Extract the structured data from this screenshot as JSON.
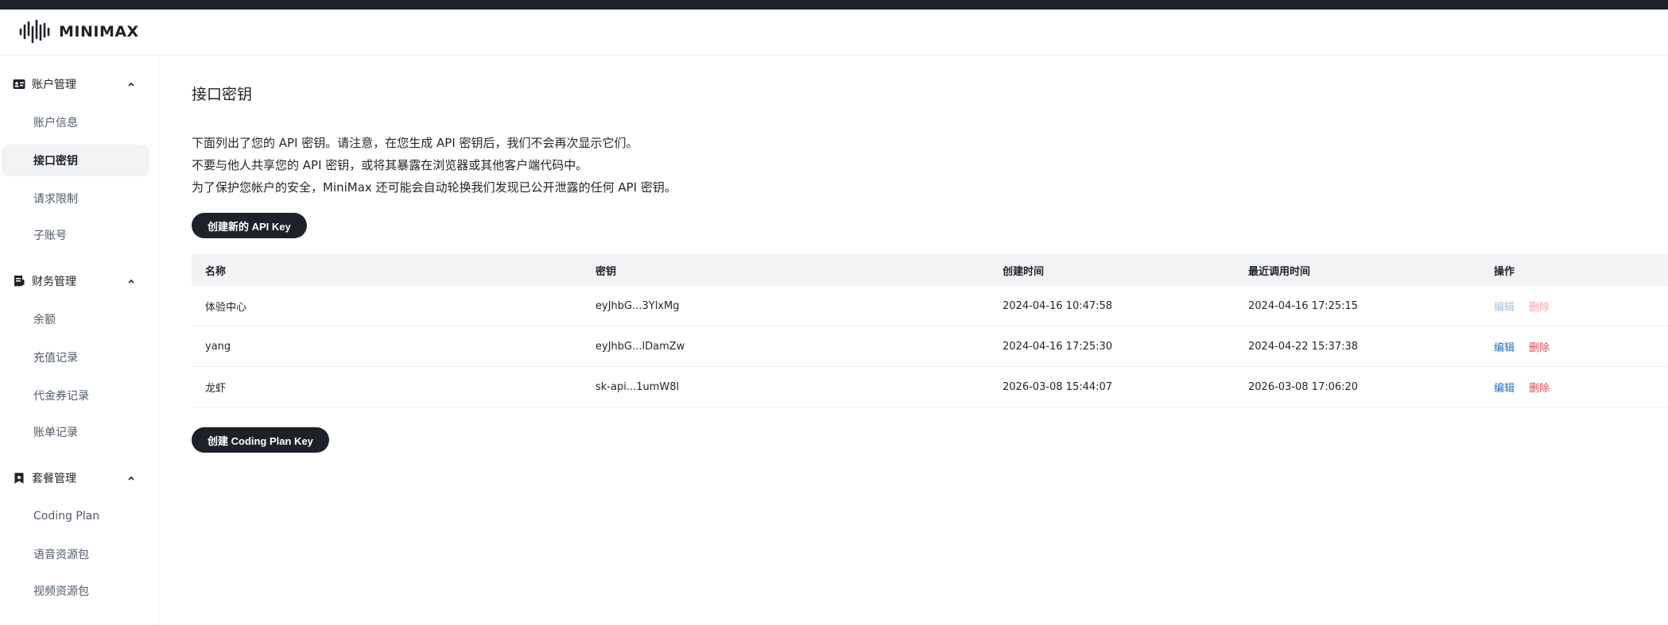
{
  "brand": {
    "name": "MINIMAX"
  },
  "sidebar": {
    "groups": [
      {
        "label": "账户管理",
        "icon": "id-card-icon",
        "items": [
          {
            "label": "账户信息"
          },
          {
            "label": "接口密钥",
            "active": true
          },
          {
            "label": "请求限制"
          },
          {
            "label": "子账号"
          }
        ]
      },
      {
        "label": "财务管理",
        "icon": "receipt-icon",
        "items": [
          {
            "label": "余额"
          },
          {
            "label": "充值记录"
          },
          {
            "label": "代金券记录"
          },
          {
            "label": "账单记录"
          }
        ]
      },
      {
        "label": "套餐管理",
        "icon": "bookmark-icon",
        "items": [
          {
            "label": "Coding Plan"
          },
          {
            "label": "语音资源包"
          },
          {
            "label": "视频资源包"
          }
        ]
      }
    ]
  },
  "main": {
    "title": "接口密钥",
    "description": [
      "下面列出了您的 API 密钥。请注意，在您生成 API 密钥后，我们不会再次显示它们。",
      "不要与他人共享您的 API 密钥，或将其暴露在浏览器或其他客户端代码中。",
      "为了保护您帐户的安全，MiniMax 还可能会自动轮换我们发现已公开泄露的任何 API 密钥。"
    ],
    "create_api_key_label": "创建新的 API Key",
    "create_coding_plan_key_label": "创建 Coding Plan Key",
    "table": {
      "columns": [
        "名称",
        "密钥",
        "创建时间",
        "最近调用时间",
        "操作"
      ],
      "rows": [
        {
          "name": "体验中心",
          "key": "eyJhbG...3YlxMg",
          "created": "2024-04-16 10:47:58",
          "last_used": "2024-04-16 17:25:15",
          "edit": "编辑",
          "delete": "删除",
          "disabled": true
        },
        {
          "name": "yang",
          "key": "eyJhbG...lDamZw",
          "created": "2024-04-16 17:25:30",
          "last_used": "2024-04-22 15:37:38",
          "edit": "编辑",
          "delete": "删除",
          "disabled": false
        },
        {
          "name": "龙虾",
          "key": "sk-api...1umW8l",
          "created": "2026-03-08 15:44:07",
          "last_used": "2026-03-08 17:06:20",
          "edit": "编辑",
          "delete": "删除",
          "disabled": false
        }
      ]
    }
  }
}
